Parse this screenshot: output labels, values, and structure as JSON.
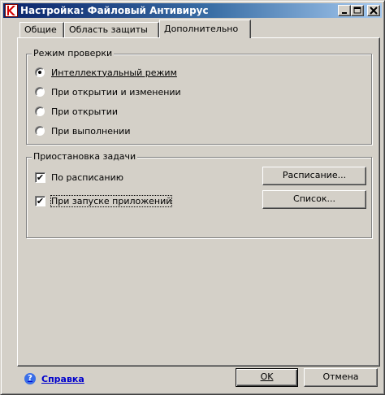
{
  "window": {
    "title": "Настройка: Файловый Антивирус",
    "buttons": {
      "minimize": "_",
      "maximize": "□",
      "close": "×"
    }
  },
  "tabs": [
    {
      "label": "Общие",
      "active": false
    },
    {
      "label": "Область защиты",
      "active": false
    },
    {
      "label": "Дополнительно",
      "active": true
    }
  ],
  "scan_mode": {
    "title": "Режим проверки",
    "options": [
      {
        "label": "Интеллектуальный режим",
        "selected": true
      },
      {
        "label": "При открытии и изменении",
        "selected": false
      },
      {
        "label": "При открытии",
        "selected": false
      },
      {
        "label": "При выполнении",
        "selected": false
      }
    ]
  },
  "task_pause": {
    "title": "Приостановка задачи",
    "items": [
      {
        "label": "По расписанию",
        "checked": true,
        "button": "Расписание..."
      },
      {
        "label": "При запуске приложений",
        "checked": true,
        "button": "Список..."
      }
    ],
    "check_mark": "✔"
  },
  "footer": {
    "help_label": "Справка",
    "help_icon": "?",
    "ok_label": "OK",
    "cancel_label": "Отмена"
  },
  "colors": {
    "title_gradient_start": "#0a246a",
    "title_gradient_end": "#a6caf0",
    "face": "#d4d0c8",
    "link": "#0000cc"
  }
}
